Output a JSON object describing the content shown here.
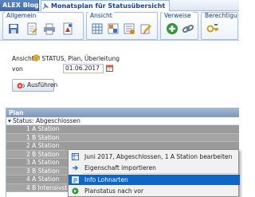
{
  "tabs": {
    "blog": "ALEX Blog",
    "close": "x",
    "active": "Monatsplan für Statusübersicht"
  },
  "ribbon": {
    "groups": [
      "Allgemein",
      "Ansicht",
      "Verweise",
      "Berechtigungen"
    ]
  },
  "form": {
    "ansicht_label": "Ansicht",
    "ansicht_value": "STATUS, Plan, Überleitung",
    "von_label": "von",
    "von_value": "01.06.2017",
    "run_button": "Ausführen"
  },
  "grid": {
    "header": "Plan",
    "status_row": "Status: Abgeschlossen",
    "rows": [
      "1 A Station",
      "1 B Station",
      "2 A Station",
      "2 B Station",
      "3 A Station",
      "3 B Station",
      "4 A Station",
      "4 B Intensivstation"
    ]
  },
  "context_menu": {
    "items": [
      "Juni 2017, Abgeschlossen, 1 A Station bearbeiten",
      "Eigenschaft importieren",
      "Info Lohnarten",
      "Planstatus nach vor"
    ]
  },
  "colors": {
    "accent": "#0b67c8",
    "grid_row": "#9b9b9b",
    "header": "#7e98ba"
  }
}
